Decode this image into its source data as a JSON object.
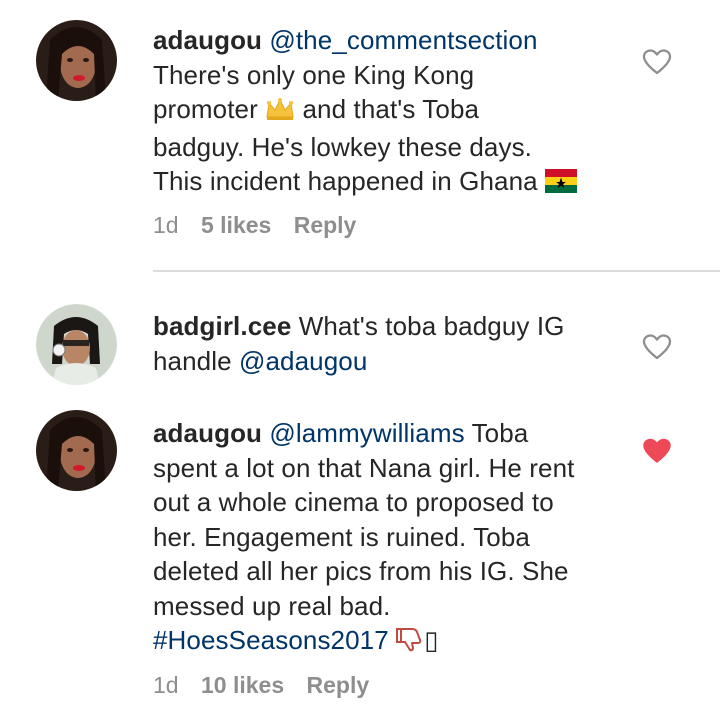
{
  "comments": [
    {
      "username": "adaugou",
      "lines": [
        {
          "parts": [
            {
              "mention": "@the_commentsection"
            }
          ]
        },
        {
          "text": "There's only one King Kong"
        },
        {
          "before": "promoter ",
          "after": " and that's Toba"
        },
        {
          "text": "badguy. He's lowkey these days."
        },
        {
          "text": "This incident happened in Ghana "
        }
      ],
      "mention": "@the_commentsection",
      "emoji_1": "crown-emoji",
      "emoji_2": "ghana-flag-emoji",
      "time": "1d",
      "likes": "5 likes",
      "reply": "Reply",
      "liked": false
    },
    {
      "username": "badgirl.cee",
      "line1_text": "What's toba badguy  IG",
      "line2_prefix": "handle ",
      "mention": "@adaugou",
      "liked": false
    },
    {
      "username": "adaugou",
      "mention": "@lammywilliams",
      "line1_suffix": " Toba",
      "lines": [
        "spent a lot on that Nana girl. He rent",
        "out a whole cinema to proposed to",
        "her. Engagement is ruined. Toba",
        "deleted all her pics from his IG. She",
        "messed up real bad."
      ],
      "hashtag": "#HoesSeasons2017",
      "trailing_glyph": "▯",
      "time": "1d",
      "likes": "10 likes",
      "reply": "Reply",
      "liked": true
    }
  ],
  "colors": {
    "text": "#262626",
    "mention": "#003569",
    "meta": "#8e8e8e",
    "heart_liked": "#ed4956",
    "divider": "#dbdbdb"
  },
  "icons": {
    "like": "heart-outline-icon",
    "liked": "heart-filled-icon",
    "dislike": "thumbs-down-emoji"
  }
}
